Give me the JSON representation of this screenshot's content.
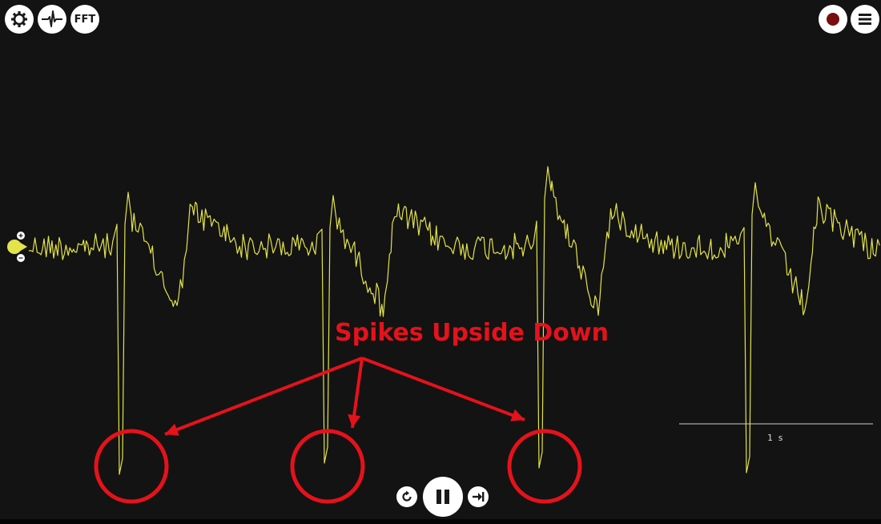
{
  "toolbar": {
    "settings_icon": "gear-icon",
    "threshold_icon": "spike-waveform-icon",
    "fft_label": "FFT",
    "record_icon": "record-icon",
    "menu_icon": "menu-icon"
  },
  "channel": {
    "color": "#e3e34a",
    "zoom_in_icon": "plus-icon",
    "zoom_out_icon": "minus-icon"
  },
  "annotation": {
    "text": "Spikes Upside Down",
    "color": "#e5121b"
  },
  "timescale": {
    "label": "1 s"
  },
  "playback": {
    "rewind_icon": "rewind-icon",
    "pause_icon": "pause-icon",
    "forward_icon": "skip-forward-icon"
  },
  "colors": {
    "background": "#131313",
    "signal": "#e3e34a",
    "annotation": "#e5121b",
    "button": "#ffffff"
  }
}
